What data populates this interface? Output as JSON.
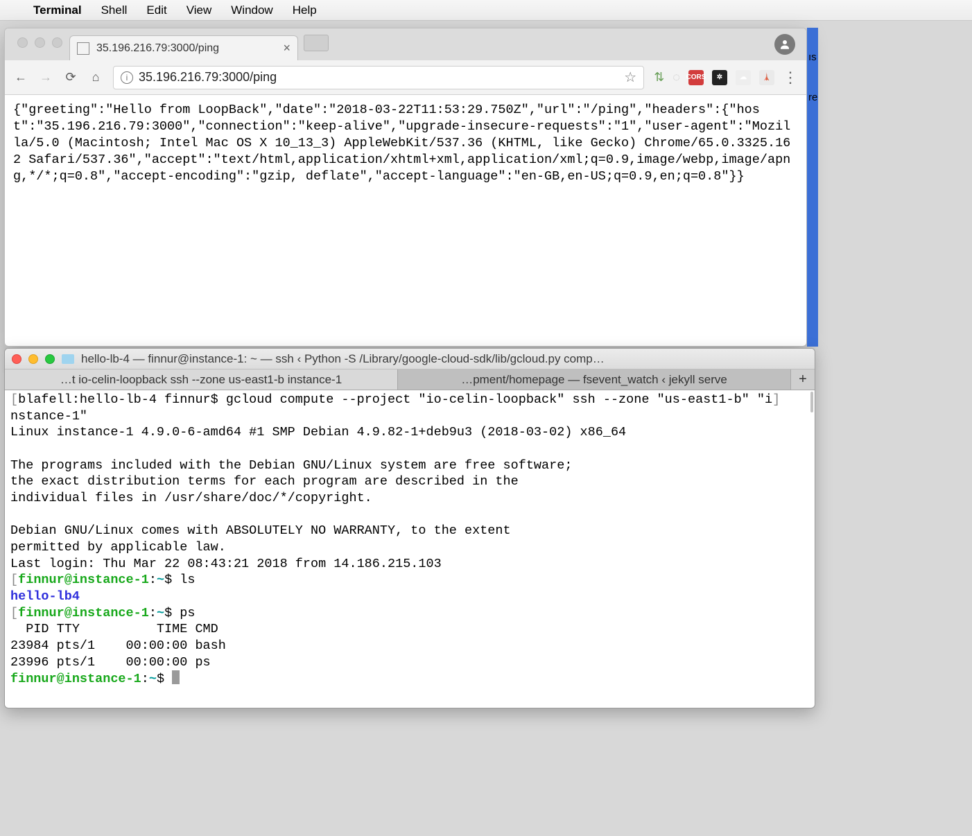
{
  "menubar": {
    "app": "Terminal",
    "items": [
      "Shell",
      "Edit",
      "View",
      "Window",
      "Help"
    ]
  },
  "chrome": {
    "tab_title": "35.196.216.79:3000/ping",
    "url": "35.196.216.79:3000/ping",
    "right_labels": {
      "l1": "ıs",
      "l2": "re"
    },
    "body": "{\"greeting\":\"Hello from LoopBack\",\"date\":\"2018-03-22T11:53:29.750Z\",\"url\":\"/ping\",\"headers\":{\"host\":\"35.196.216.79:3000\",\"connection\":\"keep-alive\",\"upgrade-insecure-requests\":\"1\",\"user-agent\":\"Mozilla/5.0 (Macintosh; Intel Mac OS X 10_13_3) AppleWebKit/537.36 (KHTML, like Gecko) Chrome/65.0.3325.162 Safari/537.36\",\"accept\":\"text/html,application/xhtml+xml,application/xml;q=0.9,image/webp,image/apng,*/*;q=0.8\",\"accept-encoding\":\"gzip, deflate\",\"accept-language\":\"en-GB,en-US;q=0.9,en;q=0.8\"}}"
  },
  "terminal": {
    "title": "hello-lb-4 — finnur@instance-1: ~ — ssh ‹ Python -S /Library/google-cloud-sdk/lib/gcloud.py comp…",
    "tabs": {
      "active": "…t io-celin-loopback ssh --zone us-east1-b instance-1",
      "other": "…pment/homepage — fsevent_watch ‹ jekyll serve"
    },
    "lines": {
      "l1a": "blafell:hello-lb-4 finnur$",
      "l1b": " gcloud compute --project \"io-celin-loopback\" ssh --zone \"us-east1-b\" \"i",
      "l2": "nstance-1\"",
      "l3": "Linux instance-1 4.9.0-6-amd64 #1 SMP Debian 4.9.82-1+deb9u3 (2018-03-02) x86_64",
      "l5": "The programs included with the Debian GNU/Linux system are free software;",
      "l6": "the exact distribution terms for each program are described in the",
      "l7": "individual files in /usr/share/doc/*/copyright.",
      "l9": "Debian GNU/Linux comes with ABSOLUTELY NO WARRANTY, to the extent",
      "l10": "permitted by applicable law.",
      "l11": "Last login: Thu Mar 22 08:43:21 2018 from 14.186.215.103",
      "p_user": "finnur@instance-1",
      "p_sep": ":",
      "p_path": "~",
      "p_dollar": "$ ",
      "cmd_ls": "ls",
      "out_ls": "hello-lb4",
      "cmd_ps": "ps",
      "ps_hdr": "  PID TTY          TIME CMD",
      "ps_r1": "23984 pts/1    00:00:00 bash",
      "ps_r2": "23996 pts/1    00:00:00 ps"
    }
  }
}
